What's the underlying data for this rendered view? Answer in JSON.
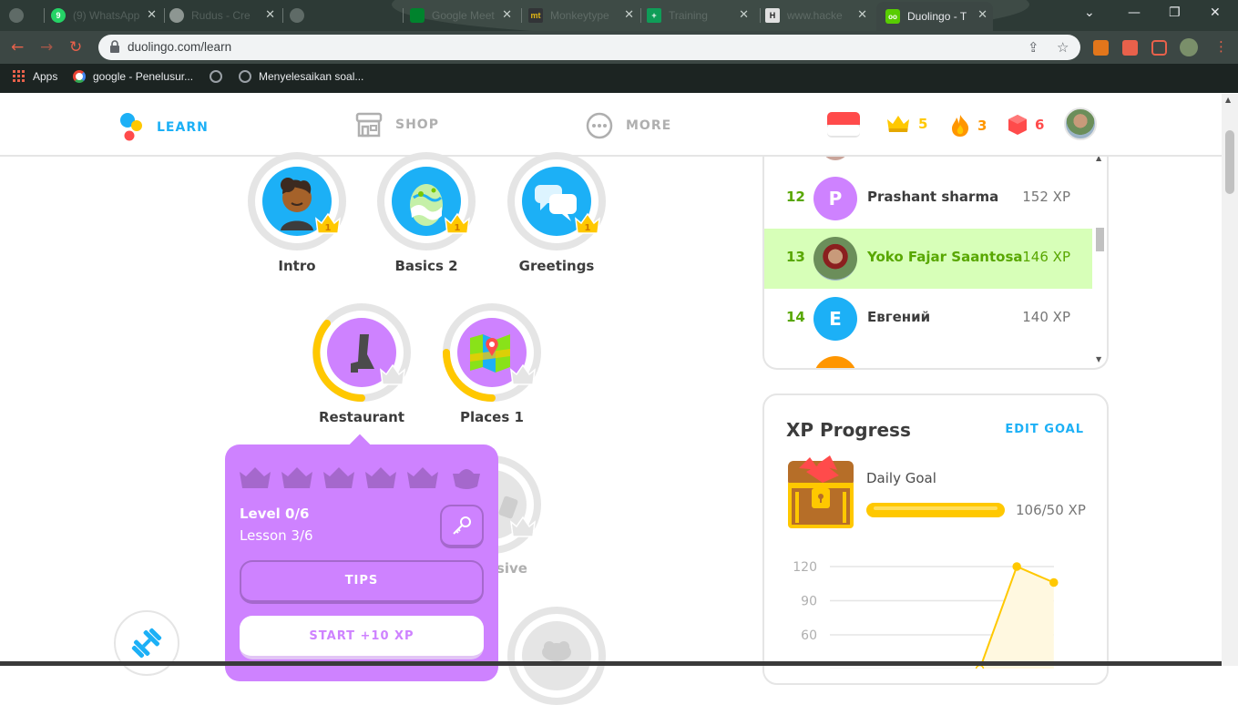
{
  "browser": {
    "tabs": [
      {
        "title": "",
        "favicon": "#8a9490"
      },
      {
        "title": "(9) WhatsApp",
        "favicon": "#25d366",
        "badge": "9"
      },
      {
        "title": "Rudus - Cre",
        "favicon": "#b0b8b5"
      },
      {
        "title": "",
        "favicon": "#8a9490"
      },
      {
        "title": "Google Meet",
        "favicon": "#00832d"
      },
      {
        "title": "Monkeytype",
        "favicon": "#e2b714"
      },
      {
        "title": "Training",
        "favicon": "#0f9d58"
      },
      {
        "title": "www.hacke",
        "favicon": "#e0e0e0"
      },
      {
        "title": "Duolingo - T",
        "favicon": "#58cc02"
      }
    ],
    "active_tab_title": "Duolingo - T",
    "url": "duolingo.com/learn",
    "bookmarks": [
      {
        "label": "Apps"
      },
      {
        "label": "google - Penelusur..."
      },
      {
        "label": ""
      },
      {
        "label": "Menyelesaikan soal..."
      }
    ]
  },
  "header": {
    "nav": [
      {
        "label": "LEARN",
        "active": true
      },
      {
        "label": "SHOP",
        "active": false
      },
      {
        "label": "MORE",
        "active": false
      }
    ],
    "crowns": "5",
    "streak": "3",
    "gems": "6",
    "colors": {
      "learn": "#1cb0f6",
      "crowns": "#ffc800",
      "streak": "#ff9600",
      "gems": "#ff4b4b"
    }
  },
  "skills": {
    "row1": [
      {
        "label": "Intro",
        "level": "1",
        "icon": "person-icon"
      },
      {
        "label": "Basics 2",
        "level": "1",
        "icon": "egg-icon"
      },
      {
        "label": "Greetings",
        "level": "1",
        "icon": "speech-bubbles-icon"
      }
    ],
    "row2": [
      {
        "label": "Restaurant",
        "icon": "boot-icon",
        "progress": 0.5
      },
      {
        "label": "Places 1",
        "icon": "map-icon",
        "progress": 0.5
      }
    ],
    "row3_partial_label": "ssive"
  },
  "popup": {
    "level": "Level 0/6",
    "lesson": "Lesson 3/6",
    "tips": "TIPS",
    "start": "START +10 XP",
    "crowns_total": 6
  },
  "leaderboard": {
    "rows": [
      {
        "rank": "12",
        "initial": "P",
        "name": "Prashant sharma",
        "xp": "152 XP",
        "color": "#ce82ff",
        "current": false
      },
      {
        "rank": "13",
        "initial": "",
        "name": "Yoko Fajar Saantosa",
        "xp": "146 XP",
        "color": "#6b8e5a",
        "current": true
      },
      {
        "rank": "14",
        "initial": "E",
        "name": "Евгений",
        "xp": "140 XP",
        "color": "#1cb0f6",
        "current": false
      }
    ]
  },
  "xp_progress": {
    "title": "XP Progress",
    "edit_label": "EDIT GOAL",
    "goal_label": "Daily Goal",
    "goal_value": "106/50 XP",
    "goal_fraction": 1.0
  },
  "chart_data": {
    "type": "area",
    "y_ticks": [
      "120",
      "90",
      "60"
    ],
    "ylim": [
      0,
      120
    ],
    "points": [
      {
        "x": 0,
        "y": 0
      },
      {
        "x": 1,
        "y": 0
      },
      {
        "x": 2,
        "y": 0
      },
      {
        "x": 3,
        "y": 0
      },
      {
        "x": 4,
        "y": 30
      },
      {
        "x": 5,
        "y": 120
      },
      {
        "x": 6,
        "y": 106
      }
    ],
    "color": "#ffc800",
    "grid": true
  }
}
